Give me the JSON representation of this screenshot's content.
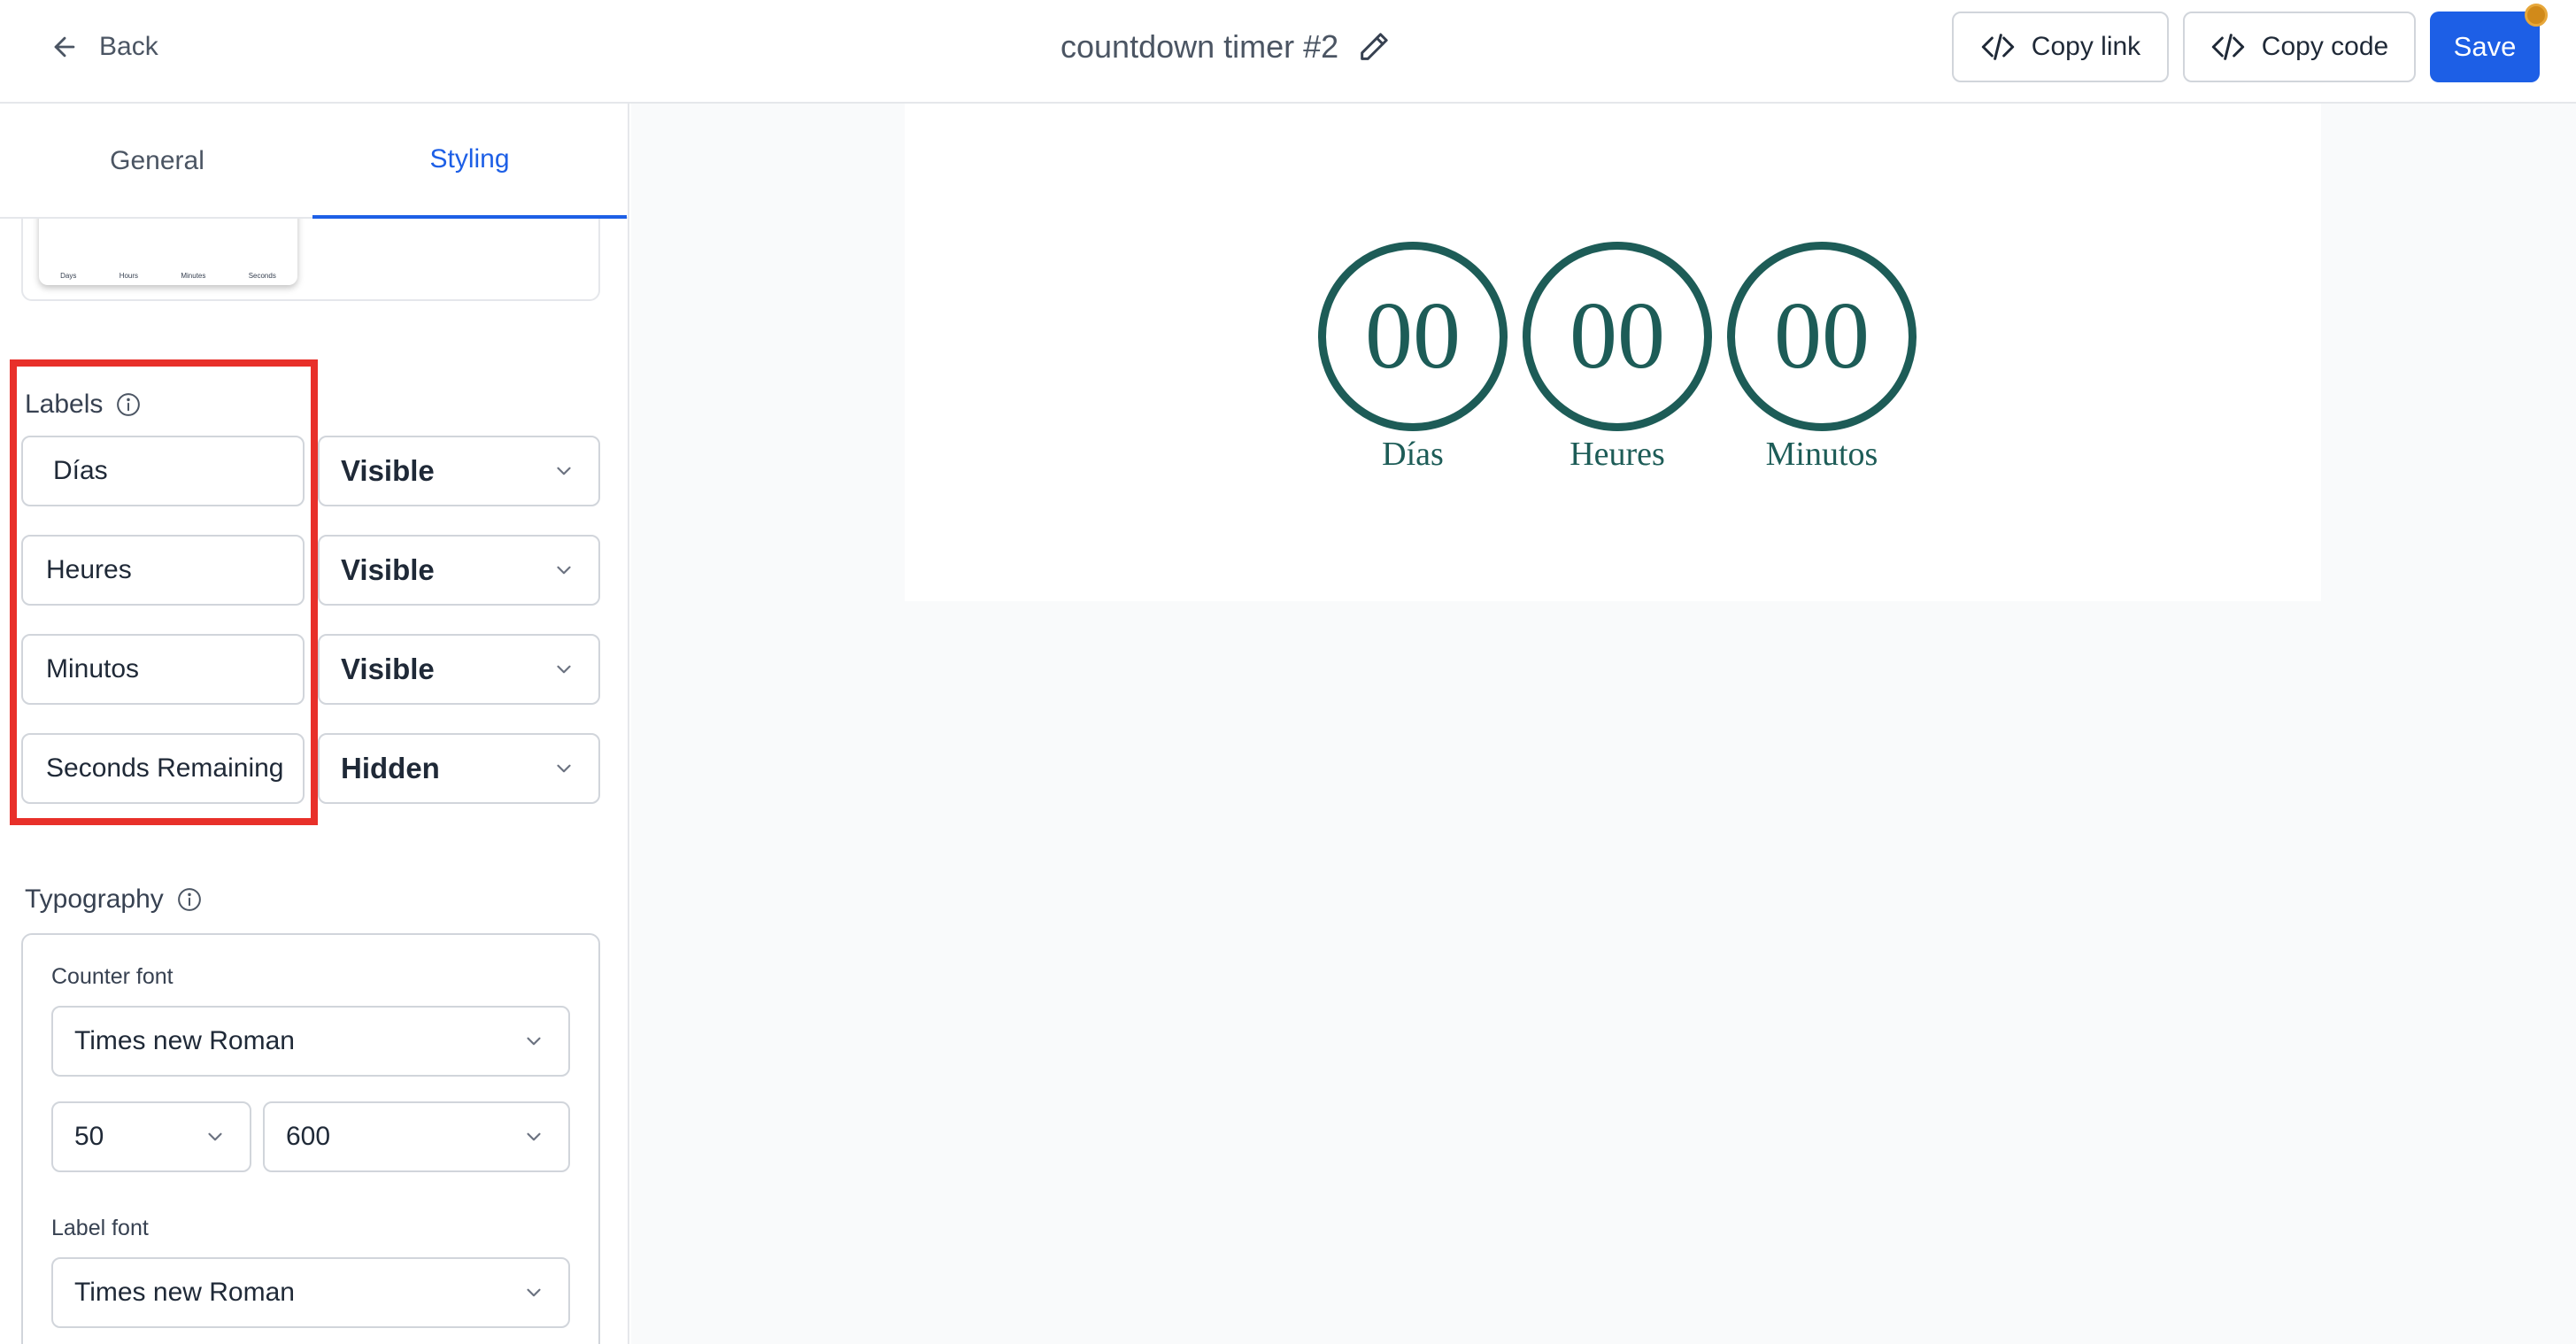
{
  "header": {
    "back_label": "Back",
    "title": "countdown timer #2",
    "copy_link_label": "Copy link",
    "copy_code_label": "Copy code",
    "save_label": "Save"
  },
  "tabs": [
    {
      "label": "General",
      "active": false
    },
    {
      "label": "Styling",
      "active": true
    }
  ],
  "mini_preview": {
    "labels": [
      "Days",
      "Hours",
      "Minutes",
      "Seconds"
    ]
  },
  "labels_section": {
    "heading": "Labels",
    "rows": [
      {
        "text": "Días",
        "visibility": "Visible"
      },
      {
        "text": "Heures",
        "visibility": "Visible"
      },
      {
        "text": "Minutos",
        "visibility": "Visible"
      },
      {
        "text": "Seconds Remaining",
        "visibility": "Hidden"
      }
    ]
  },
  "typography": {
    "heading": "Typography",
    "counter_font_label": "Counter font",
    "counter_font": "Times new Roman",
    "counter_size": "50",
    "counter_weight": "600",
    "label_font_label": "Label font",
    "label_font": "Times new Roman"
  },
  "preview": {
    "units": [
      {
        "value": "00",
        "label": "Días"
      },
      {
        "value": "00",
        "label": "Heures"
      },
      {
        "value": "00",
        "label": "Minutos"
      }
    ]
  },
  "colors": {
    "accent": "#1d5fe6",
    "timer": "#1d5c57",
    "highlight": "#e8302a",
    "notification_dot": "#d18a1a"
  }
}
